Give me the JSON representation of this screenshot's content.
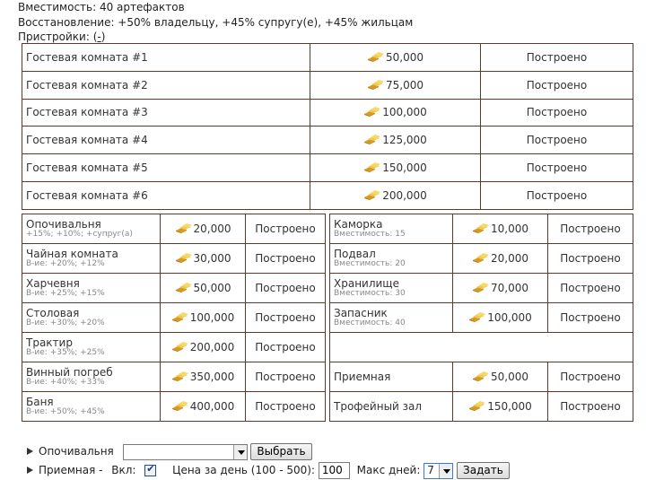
{
  "header": {
    "capacity": "Вместимость: 40 артефактов",
    "recovery": "Восстановление: +50% владельцу, +45% супругу(е), +45% жильцам",
    "annex_label": "Пристройки:",
    "annex_toggle": "-"
  },
  "guest_rooms": [
    {
      "name": "Гостевая комната #1",
      "price": "50,000",
      "status": "Построено"
    },
    {
      "name": "Гостевая комната #2",
      "price": "75,000",
      "status": "Построено"
    },
    {
      "name": "Гостевая комната #3",
      "price": "100,000",
      "status": "Построено"
    },
    {
      "name": "Гостевая комната #4",
      "price": "125,000",
      "status": "Построено"
    },
    {
      "name": "Гостевая комната #5",
      "price": "150,000",
      "status": "Построено"
    },
    {
      "name": "Гостевая комната #6",
      "price": "200,000",
      "status": "Построено"
    }
  ],
  "left_rooms": [
    {
      "name": "Опочивальня",
      "sub": "+15%; +10%; +супруг(а)",
      "price": "20,000",
      "status": "Построено"
    },
    {
      "name": "Чайная комната",
      "sub": "В-ие: +20%; +12%",
      "price": "30,000",
      "status": "Построено"
    },
    {
      "name": "Харчевня",
      "sub": "В-ие: +25%; +15%",
      "price": "50,000",
      "status": "Построено"
    },
    {
      "name": "Столовая",
      "sub": "В-ие: +30%; +20%",
      "price": "100,000",
      "status": "Построено"
    },
    {
      "name": "Трактир",
      "sub": "В-ие: +35%; +25%",
      "price": "200,000",
      "status": "Построено"
    },
    {
      "name": "Винный погреб",
      "sub": "В-ие: +40%; +33%",
      "price": "350,000",
      "status": "Построено"
    },
    {
      "name": "Баня",
      "sub": "В-ие: +50%; +45%",
      "price": "400,000",
      "status": "Построено"
    }
  ],
  "right_rooms": [
    {
      "name": "Каморка",
      "sub": "Вместимость: 15",
      "price": "10,000",
      "status": "Построено"
    },
    {
      "name": "Подвал",
      "sub": "Вместимость: 20",
      "price": "20,000",
      "status": "Построено"
    },
    {
      "name": "Хранилище",
      "sub": "Вместимость: 30",
      "price": "70,000",
      "status": "Построено"
    },
    {
      "name": "Запасник",
      "sub": "Вместимость: 40",
      "price": "100,000",
      "status": "Построено"
    },
    {
      "name": "Приемная",
      "sub": "",
      "price": "50,000",
      "status": "Построено"
    },
    {
      "name": "Трофейный зал",
      "sub": "",
      "price": "150,000",
      "status": "Построено"
    }
  ],
  "controls": {
    "bedroom_label": "Опочивальня",
    "bedroom_select_value": "",
    "choose_button": "Выбрать",
    "reception_label": "Приемная -",
    "enabled_label": "Вкл:",
    "enabled_checked": true,
    "price_label": "Цена за день (100 - 500):",
    "price_value": "100",
    "max_days_label": "Макс дней:",
    "max_days_value": "7",
    "set_button": "Задать"
  },
  "icons": {
    "coin": "gold-bars-icon",
    "expand": "triangle-right-icon"
  },
  "colors": {
    "border": "#5a3a2a",
    "gold": "#e8b83a"
  }
}
